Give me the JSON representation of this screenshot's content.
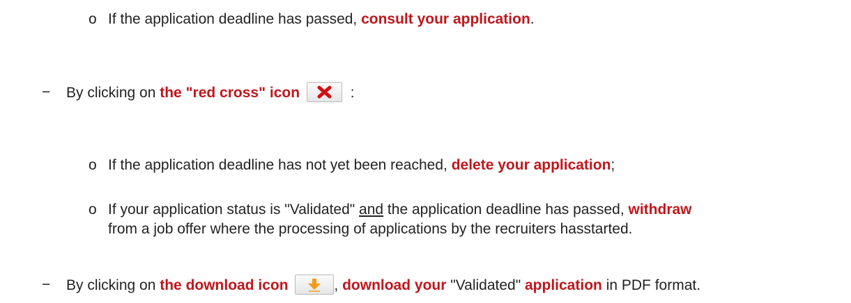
{
  "bullets": {
    "sub": "o",
    "main": "−"
  },
  "line1": {
    "a": "If the application deadline has passed, ",
    "b": "consult your application",
    "c": "."
  },
  "item1": {
    "a": "By clicking on ",
    "b": "the \"red cross\" icon",
    "c": " :",
    "icon": "red-cross-icon"
  },
  "item1_sub1": {
    "a": "If the application deadline has not yet been reached, ",
    "b": "delete your application",
    "c": ";"
  },
  "item1_sub2": {
    "a": "If your application status is \"Validated\" ",
    "b": "and",
    "c": " the application deadline has passed, ",
    "d": "withdraw",
    "e": "from a job offer where the processing of applications by the recruiters hasstarted."
  },
  "item2": {
    "a": "By clicking on ",
    "b": "the download icon",
    "c": ", ",
    "d": "download your",
    "e": " \"Validated\" ",
    "f": "application",
    "g": " in PDF format.",
    "icon": "download-icon"
  },
  "colors": {
    "highlight": "#c0161b",
    "text": "#222222"
  }
}
